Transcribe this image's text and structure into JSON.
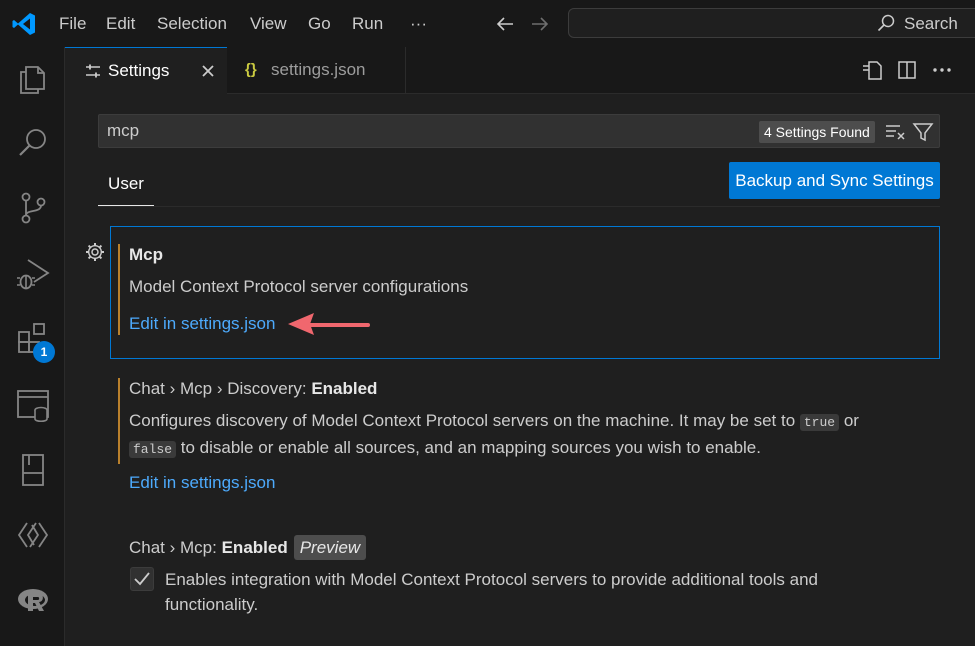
{
  "titlebar": {
    "menu": [
      "File",
      "Edit",
      "Selection",
      "View",
      "Go",
      "Run",
      "···"
    ],
    "search_label": "Search"
  },
  "activity_bar": {
    "items": [
      "explorer-icon",
      "search-icon",
      "source-control-icon",
      "run-debug-icon",
      "extensions-icon",
      "remote-explorer-icon",
      "book-icon",
      "copilot-icon",
      "r-icon"
    ],
    "extensions_badge": "1"
  },
  "tabs": [
    {
      "label": "Settings",
      "active": true
    },
    {
      "label": "settings.json",
      "active": false
    }
  ],
  "settings": {
    "search_value": "mcp",
    "found_count": "4 Settings Found",
    "scope_tab": "User",
    "sync_button": "Backup and Sync Settings",
    "items": [
      {
        "title_prefix": "",
        "title_bold": "Mcp",
        "description": "Model Context Protocol server configurations",
        "link": "Edit in settings.json"
      },
      {
        "title_prefix": "Chat › Mcp › Discovery: ",
        "title_bold": "Enabled",
        "description_part1": "Configures discovery of Model Context Protocol servers on the machine. It may be set to ",
        "code1": "true",
        "description_part2": " or ",
        "code2": "false",
        "description_part3": " to disable or enable all sources, and an mapping sources you wish to enable.",
        "link": "Edit in settings.json"
      },
      {
        "title_prefix": "Chat › Mcp: ",
        "title_bold": "Enabled",
        "tag": "Preview",
        "description": "Enables integration with Model Context Protocol servers to provide additional tools and functionality.",
        "checked": true
      }
    ]
  },
  "colors": {
    "accent": "#0078d4",
    "link": "#4daafc",
    "modified_indicator": "#b9802c",
    "annotation_arrow": "#f0676e"
  }
}
